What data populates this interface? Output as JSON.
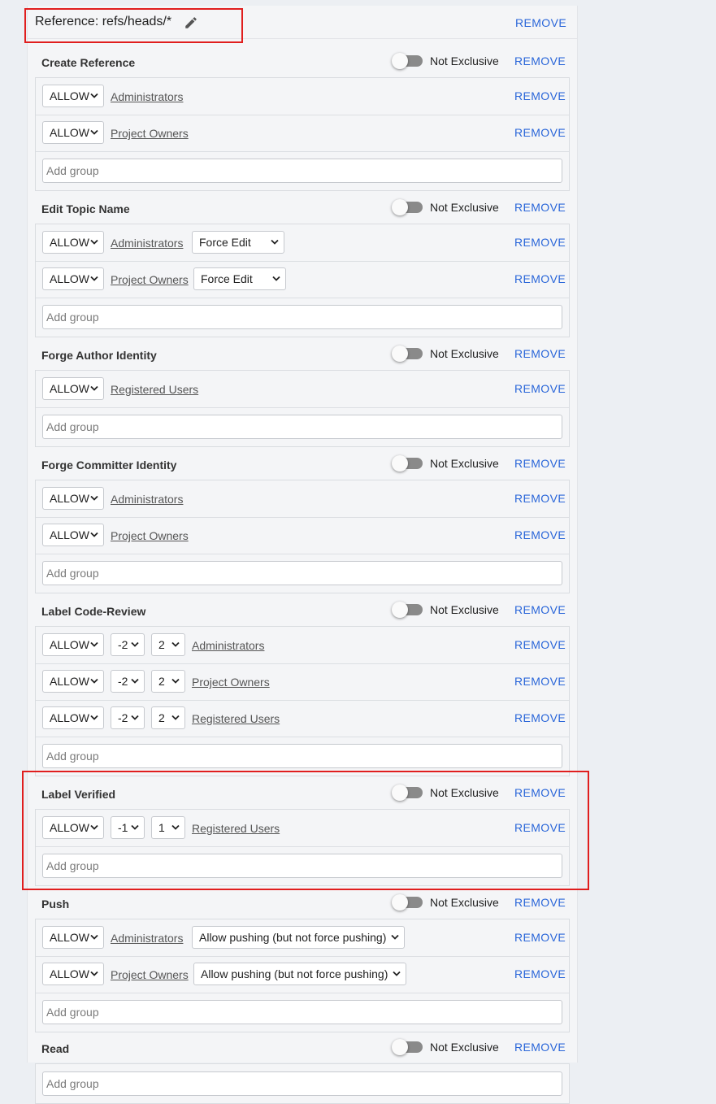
{
  "reference": {
    "label": "Reference: refs/heads/*",
    "remove_label": "REMOVE"
  },
  "common": {
    "remove_label": "REMOVE",
    "exclusive_label": "Not Exclusive",
    "add_group_placeholder": "Add group",
    "action_value": "ALLOW",
    "edit_icon": "pencil-icon",
    "accent_color": "#2a66d9",
    "highlight_color": "#e01e1e"
  },
  "permissions": [
    {
      "title": "Create Reference",
      "rules": [
        {
          "action": "ALLOW",
          "group": "Administrators"
        },
        {
          "action": "ALLOW",
          "group": "Project Owners"
        }
      ]
    },
    {
      "title": "Edit Topic Name",
      "rules": [
        {
          "action": "ALLOW",
          "group": "Administrators",
          "force": "Force Edit"
        },
        {
          "action": "ALLOW",
          "group": "Project Owners",
          "force": "Force Edit"
        }
      ]
    },
    {
      "title": "Forge Author Identity",
      "rules": [
        {
          "action": "ALLOW",
          "group": "Registered Users"
        }
      ]
    },
    {
      "title": "Forge Committer Identity",
      "rules": [
        {
          "action": "ALLOW",
          "group": "Administrators"
        },
        {
          "action": "ALLOW",
          "group": "Project Owners"
        }
      ]
    },
    {
      "title": "Label Code-Review",
      "rules": [
        {
          "action": "ALLOW",
          "min": "-2",
          "max": "2",
          "group": "Administrators"
        },
        {
          "action": "ALLOW",
          "min": "-2",
          "max": "2",
          "group": "Project Owners"
        },
        {
          "action": "ALLOW",
          "min": "-2",
          "max": "2",
          "group": "Registered Users"
        }
      ]
    },
    {
      "title": "Label Verified",
      "rules": [
        {
          "action": "ALLOW",
          "min": "-1",
          "max": "1",
          "group": "Registered Users"
        }
      ]
    },
    {
      "title": "Push",
      "rules": [
        {
          "action": "ALLOW",
          "group": "Administrators",
          "force": "Allow pushing (but not force pushing)"
        },
        {
          "action": "ALLOW",
          "group": "Project Owners",
          "force": "Allow pushing (but not force pushing)"
        }
      ]
    },
    {
      "title": "Read",
      "rules": []
    }
  ]
}
